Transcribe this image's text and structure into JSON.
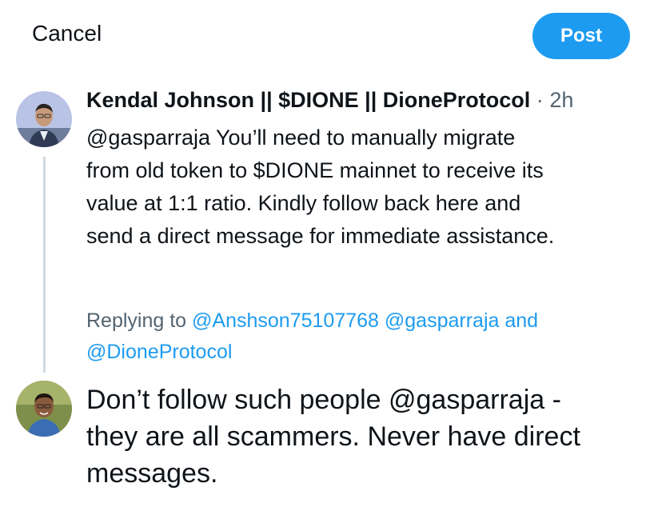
{
  "header": {
    "cancel_label": "Cancel",
    "post_label": "Post",
    "post_color": "#1d9bf0"
  },
  "original_tweet": {
    "author_name": "Kendal Johnson || $DIONE || DioneProtocol",
    "separator": "·",
    "time": "2h",
    "text_lines": [
      "@gasparraja You’ll need to manually migrate",
      "from old  token to $DIONE mainnet to receive its",
      "value at 1:1 ratio. Kindly follow back here and",
      "send a direct message for immediate assistance."
    ]
  },
  "replying_to": {
    "label": "Replying to",
    "mention_1": "@Anshson75107768",
    "mention_2": "@gasparraja",
    "connector": "and",
    "mention_3": "@DioneProtocol"
  },
  "compose": {
    "text_lines": [
      "Don’t follow such people @gasparraja -",
      "they are all scammers. Never have direct",
      "messages."
    ]
  },
  "colors": {
    "link": "#1d9bf0",
    "muted": "#536471",
    "text": "#0f1419",
    "thread_line": "#cfd9de"
  }
}
